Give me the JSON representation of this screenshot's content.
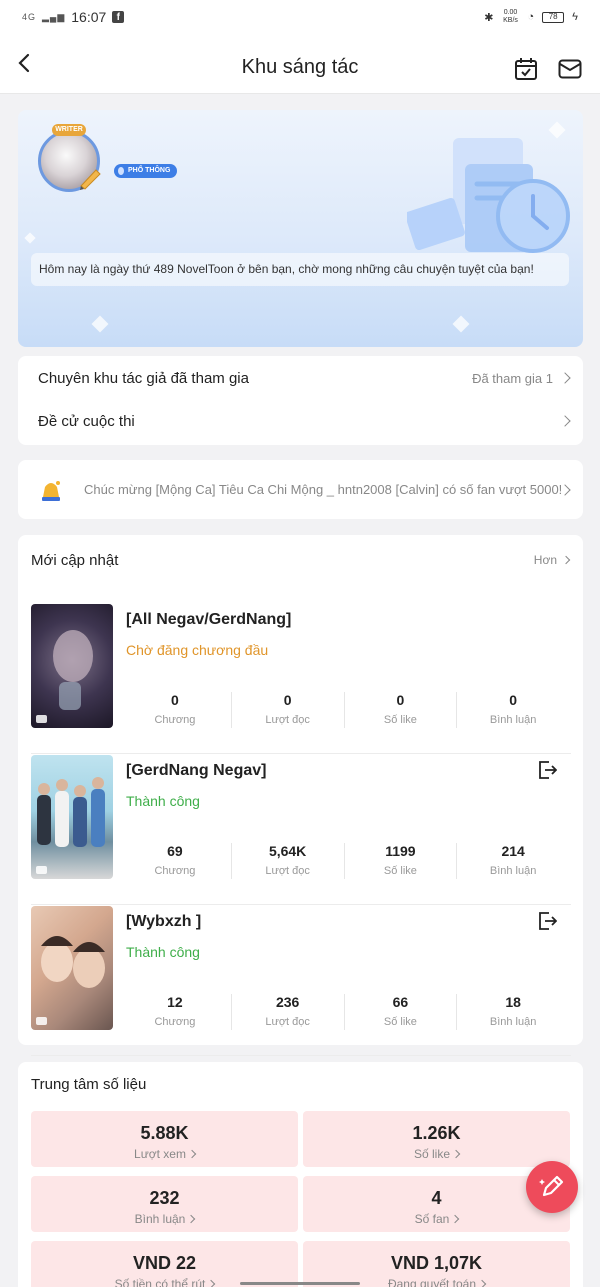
{
  "status_bar": {
    "network": "4G",
    "time": "16:07",
    "speed": "0.00 KB/s",
    "battery": "78"
  },
  "header": {
    "title": "Khu sáng tác"
  },
  "profile": {
    "writer_tag": "WRITER",
    "level_badge": "PHỔ THÔNG",
    "welcome_message": "Hôm nay là ngày thứ 489 NovelToon ở bên bạn, chờ mong những câu chuyện tuyệt của bạn!"
  },
  "links": {
    "joined_zone_label": "Chuyên khu tác giả đã tham gia",
    "joined_zone_value": "Đã tham gia 1",
    "contest_label": "Đề cử cuộc thi"
  },
  "notice": {
    "text": "Chúc mừng [Mộng Ca] Tiêu Ca Chi Mộng _ hntn2008 [Calvin] có số fan vượt 5000!"
  },
  "updates": {
    "title": "Mới cập nhật",
    "more_label": "Hơn",
    "stat_labels": {
      "chapters": "Chương",
      "reads": "Lượt đọc",
      "likes": "Số like",
      "comments": "Bình luận"
    },
    "works": [
      {
        "title": "[All Negav/GerdNang]",
        "status": "Chờ đăng chương đầu",
        "status_color": "#e0952a",
        "chapters": "0",
        "reads": "0",
        "likes": "0",
        "comments": "0"
      },
      {
        "title": "[GerdNang Negav]",
        "status": "Thành công",
        "status_color": "#3fae4a",
        "chapters": "69",
        "reads": "5,64K",
        "likes": "1199",
        "comments": "214"
      },
      {
        "title": "[Wybxzh ]",
        "status": "Thành công",
        "status_color": "#3fae4a",
        "chapters": "12",
        "reads": "236",
        "likes": "66",
        "comments": "18"
      }
    ]
  },
  "data_center": {
    "title": "Trung tâm số liệu",
    "tiles": [
      {
        "value": "5.88K",
        "label": "Lượt xem"
      },
      {
        "value": "1.26K",
        "label": "Số like"
      },
      {
        "value": "232",
        "label": "Bình luận"
      },
      {
        "value": "4",
        "label": "Số fan"
      },
      {
        "value": "VND 22",
        "label": "Số tiền có thể rút"
      },
      {
        "value": "VND 1,07K",
        "label": "Đang quyết toán"
      }
    ]
  },
  "colors": {
    "accent_red": "#ee4b5b",
    "banner_blue": "#dde9fa",
    "success_green": "#3fae4a",
    "pending_orange": "#e0952a"
  }
}
